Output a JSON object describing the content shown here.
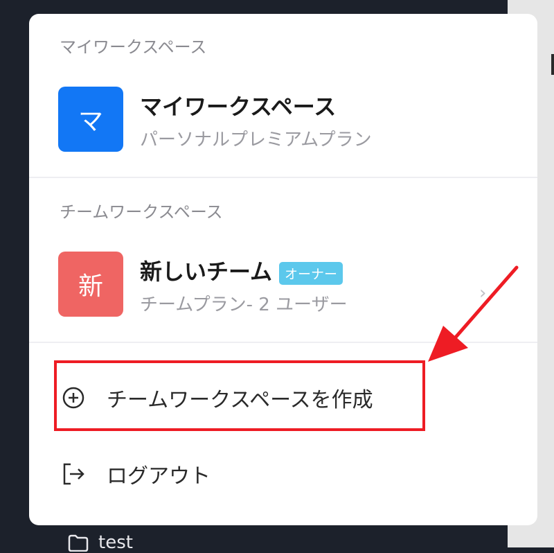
{
  "my_workspace": {
    "section_label": "マイワークスペース",
    "avatar_letter": "マ",
    "avatar_color": "#1277f5",
    "name": "マイワークスペース",
    "plan": "パーソナルプレミアムプラン"
  },
  "team_workspace": {
    "section_label": "チームワークスペース",
    "avatar_letter": "新",
    "avatar_color": "#ef6563",
    "name": "新しいチーム",
    "badge": "オーナー",
    "badge_color": "#5cc8ec",
    "plan": "チームプラン- 2 ユーザー"
  },
  "actions": {
    "create_team": "チームワークスペースを作成",
    "logout": "ログアウト"
  },
  "background": {
    "folder_label": "test"
  },
  "annotation_color": "#ee1c24"
}
